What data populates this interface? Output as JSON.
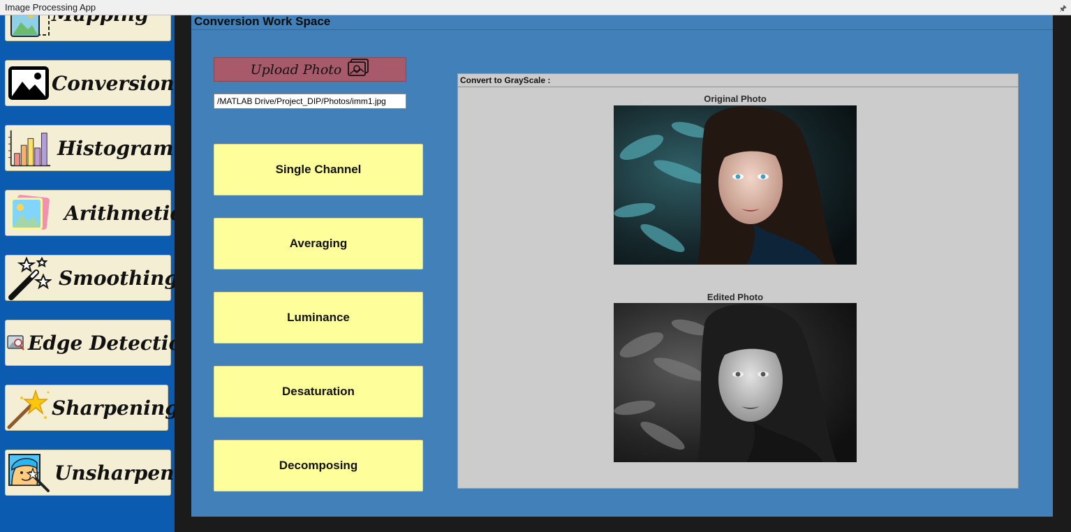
{
  "window": {
    "title": "Image Processing App",
    "pin_glyph": "🖈"
  },
  "sidebar": {
    "items": [
      {
        "label": "Mapping",
        "icon": "image-mapping-icon"
      },
      {
        "label": "Conversion",
        "icon": "landscape-photo-icon"
      },
      {
        "label": "Histogram",
        "icon": "bar-chart-icon"
      },
      {
        "label": "Arithmetic",
        "icon": "photo-stack-icon"
      },
      {
        "label": "Smoothing",
        "icon": "magic-wand-stars-icon"
      },
      {
        "label": "Edge Detection",
        "icon": "image-search-icon"
      },
      {
        "label": "Sharpening",
        "icon": "sparkle-wand-icon"
      },
      {
        "label": "Unsharpen",
        "icon": "face-wand-icon"
      }
    ]
  },
  "workspace": {
    "title": "Conversion Work Space",
    "upload_label": "Upload Photo",
    "file_path": "/MATLAB Drive/Project_DIP/Photos/imm1.jpg",
    "buttons": [
      "Single Channel",
      "Averaging",
      "Luminance",
      "Desaturation",
      "Decomposing"
    ]
  },
  "panel": {
    "title": "Convert to GrayScale :",
    "original_caption": "Original Photo",
    "edited_caption": "Edited Photo"
  },
  "colors": {
    "sidebar_bg": "#0b5cb0",
    "workspace_bg": "#4180b8",
    "nav_button_bg": "#f3eed4",
    "upload_bg": "#a85a6a",
    "conversion_button_bg": "#fefe9b",
    "panel_bg": "#cccccc"
  }
}
